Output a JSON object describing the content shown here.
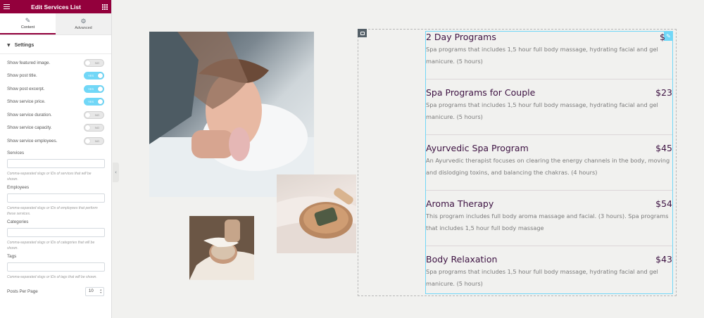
{
  "sidebar": {
    "title": "Edit Services List",
    "tabs": [
      {
        "label": "Content",
        "icon": "pencil-icon"
      },
      {
        "label": "Advanced",
        "icon": "gear-icon"
      }
    ],
    "section": "Settings",
    "toggles": [
      {
        "label": "Show featured image.",
        "state": "no"
      },
      {
        "label": "Show post title.",
        "state": "yes"
      },
      {
        "label": "Show post excerpt.",
        "state": "yes"
      },
      {
        "label": "Show service price.",
        "state": "yes"
      },
      {
        "label": "Show service duration.",
        "state": "no"
      },
      {
        "label": "Show service capacity.",
        "state": "no"
      },
      {
        "label": "Show service employees.",
        "state": "no"
      }
    ],
    "toggle_on_text": "YES",
    "toggle_off_text": "NO",
    "fields": [
      {
        "label": "Services",
        "value": "",
        "desc": "Comma-separated slugs or IDs of services that will be shown."
      },
      {
        "label": "Employees",
        "value": "",
        "desc": "Comma-separated slugs or IDs of employees that perform these services."
      },
      {
        "label": "Categories",
        "value": "",
        "desc": "Comma-separated slugs or IDs of categories that will be shown."
      },
      {
        "label": "Tags",
        "value": "",
        "desc": "Comma-separated slugs or IDs of tags that will be shown."
      }
    ],
    "posts_per_page": {
      "label": "Posts Per Page",
      "value": "10"
    }
  },
  "services": [
    {
      "title": "2 Day Programs",
      "price": "$",
      "desc": "Spa programs that includes 1,5 hour full body massage, hydrating facial and gel manicure. (5 hours)"
    },
    {
      "title": "Spa Programs for Couple",
      "price": "$23",
      "desc": "Spa programs that includes 1,5 hour full body massage, hydrating facial and gel manicure. (5 hours)"
    },
    {
      "title": "Ayurvedic Spa Program",
      "price": "$45",
      "desc": "An Ayurvedic therapist focuses on clearing the energy channels in the body, moving and dislodging toxins, and balancing the chakras. (4 hours)"
    },
    {
      "title": "Aroma Therapy",
      "price": "$54",
      "desc": "This program includes full body aroma massage and facial. (3 hours). Spa programs that includes 1,5 hour full body massage"
    },
    {
      "title": "Body Relaxation",
      "price": "$43",
      "desc": "Spa programs that includes 1,5 hour full body massage, hydrating facial and gel manicure. (5 hours)"
    }
  ],
  "colors": {
    "brand": "#93003c",
    "accent": "#71d7f7",
    "title": "#3d1242"
  }
}
